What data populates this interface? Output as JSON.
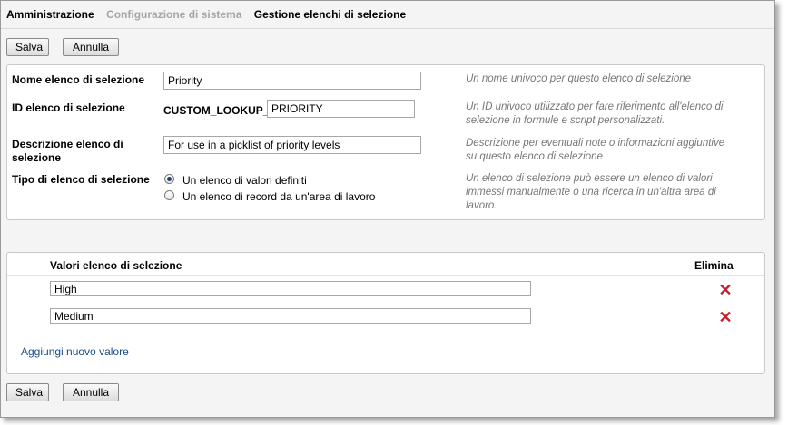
{
  "breadcrumb": {
    "admin": "Amministrazione",
    "config": "Configurazione di sistema",
    "current": "Gestione elenchi di selezione"
  },
  "buttons": {
    "save": "Salva",
    "cancel": "Annulla"
  },
  "form": {
    "name": {
      "label": "Nome elenco di selezione",
      "value": "Priority",
      "help": "Un nome univoco per questo elenco di selezione"
    },
    "id": {
      "label": "ID elenco di selezione",
      "prefix": "CUSTOM_LOOKUP_",
      "value": "PRIORITY",
      "help1": "Un ID univoco utilizzato per fare riferimento all'elenco di",
      "help2": "selezione in formule e script personalizzati."
    },
    "description": {
      "label1": "Descrizione elenco di",
      "label2": "selezione",
      "value": "For use in a picklist of priority levels",
      "help1": "Descrizione per eventuali note o informazioni aggiuntive",
      "help2": "su questo elenco di selezione"
    },
    "type": {
      "label": "Tipo di elenco di selezione",
      "options": [
        "Un elenco di valori definiti",
        "Un elenco di record da un'area di lavoro"
      ],
      "selected": 0,
      "help1": "Un elenco di selezione può essere un elenco di valori",
      "help2": "immessi manualmente o una ricerca in un'altra area di",
      "help3": "lavoro."
    }
  },
  "values_table": {
    "header_values": "Valori elenco di selezione",
    "header_delete": "Elimina",
    "rows": [
      "High",
      "Medium"
    ],
    "add_link": "Aggiungi nuovo valore"
  },
  "icons": {
    "delete": "delete-x-icon",
    "delete_color": "#c8202a"
  }
}
